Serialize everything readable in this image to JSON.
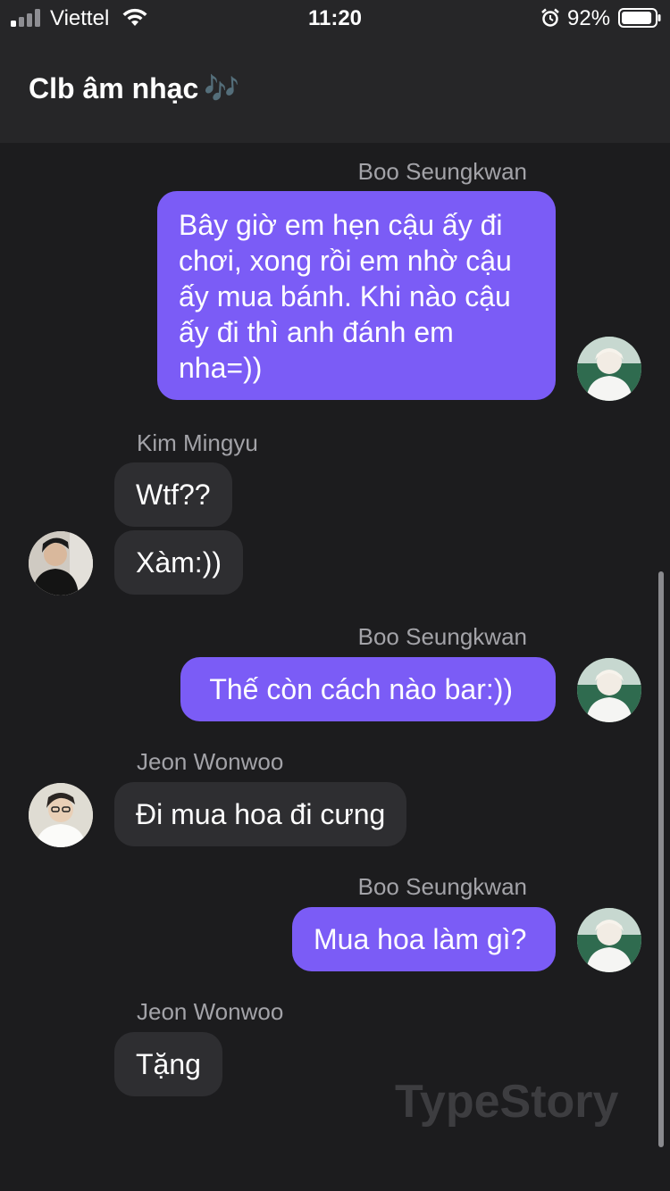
{
  "status_bar": {
    "carrier": "Viettel",
    "time": "11:20",
    "battery_percent": "92%",
    "battery_level": 0.92,
    "icons": [
      "signal-icon",
      "wifi-icon",
      "alarm-icon",
      "battery-icon"
    ]
  },
  "header": {
    "title": "Clb âm nhạc",
    "title_emoji": "🎶"
  },
  "messages": [
    {
      "sender": "Boo Seungkwan",
      "direction": "outgoing",
      "lines": [
        "Bây giờ em hẹn cậu ấy đi",
        "chơi, xong rồi em nhờ cậu",
        "ấy mua bánh. Khi nào cậu",
        "ấy đi thì anh đánh em",
        "nha=))"
      ]
    },
    {
      "sender": "Kim Mingyu",
      "direction": "incoming",
      "text": "Wtf??"
    },
    {
      "sender": "Kim Mingyu",
      "direction": "incoming",
      "text": "Xàm:))"
    },
    {
      "sender": "Boo Seungkwan",
      "direction": "outgoing",
      "text": " Thế còn cách nào bar:))"
    },
    {
      "sender": "Jeon Wonwoo",
      "direction": "incoming",
      "text": "Đi mua hoa đi cưng"
    },
    {
      "sender": "Boo Seungkwan",
      "direction": "outgoing",
      "text": "Mua hoa làm gì?"
    },
    {
      "sender": "Jeon Wonwoo",
      "direction": "incoming",
      "text": "Tặng"
    }
  ],
  "watermark": "TypeStory",
  "colors": {
    "background": "#1c1c1e",
    "header": "#262628",
    "outgoing_bubble": "#7b5cf6",
    "incoming_bubble": "#2e2e31",
    "sender_name": "#a3a3a8"
  }
}
